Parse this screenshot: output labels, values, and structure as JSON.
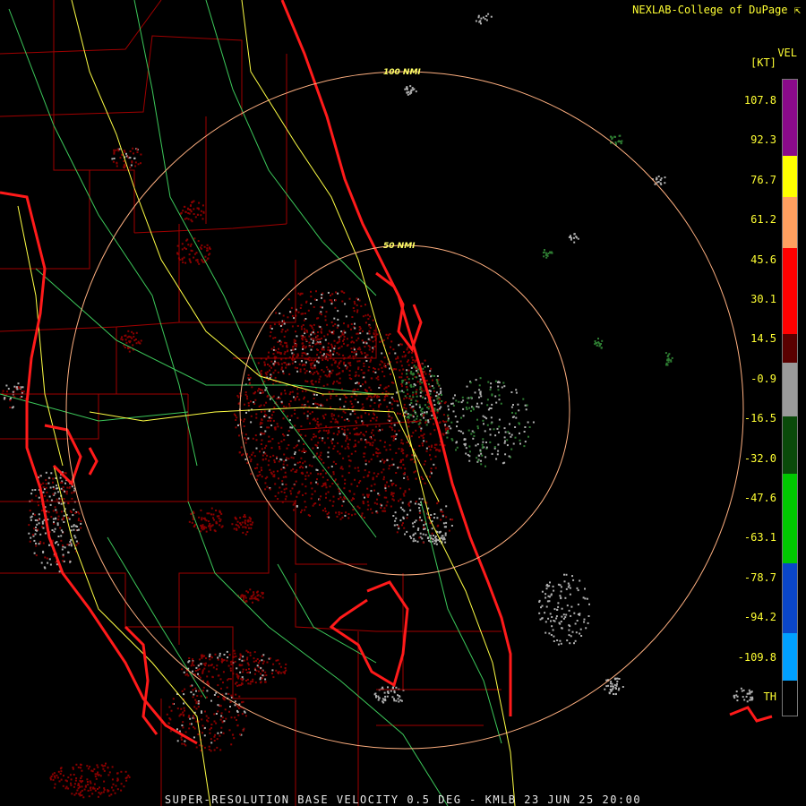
{
  "credit": "NEXLAB-College of DuPage",
  "credit_icon": "corner-arrow-icon",
  "footer": "SUPER-RESOLUTION BASE VELOCITY 0.5 DEG - KMLB 23 JUN 25 20:00",
  "range_rings": [
    {
      "label": "100 NMI"
    },
    {
      "label": "50 NMI"
    }
  ],
  "legend": {
    "title": "VEL",
    "unit": "[KT]",
    "ticks": [
      "107.8",
      "92.3",
      "76.7",
      "61.2",
      "45.6",
      "30.1",
      "14.5",
      "-0.9",
      "-16.5",
      "-32.0",
      "-47.6",
      "-63.1",
      "-78.7",
      "-94.2",
      "-109.8",
      "TH"
    ],
    "colors": {
      "purple": "#8a0a8a",
      "yellow": "#ffff00",
      "orange": "#ffa060",
      "red": "#ff0000",
      "dark_red": "#5a0000",
      "gray": "#9a9a9a",
      "dark_green": "#0a4a0a",
      "green": "#00c800",
      "blue": "#0a46c8",
      "light_blue": "#00a0ff",
      "black": "#000000"
    }
  },
  "map_colors": {
    "coast": "#ff1a1a",
    "county": "#b00000",
    "highway": "#ffff44",
    "road": "#3cc85a",
    "ring": "#ffb080",
    "echo_inbound": "#8b0000",
    "echo_outbound": "#2e7d32",
    "echo_neutral": "#b0b0b0"
  }
}
